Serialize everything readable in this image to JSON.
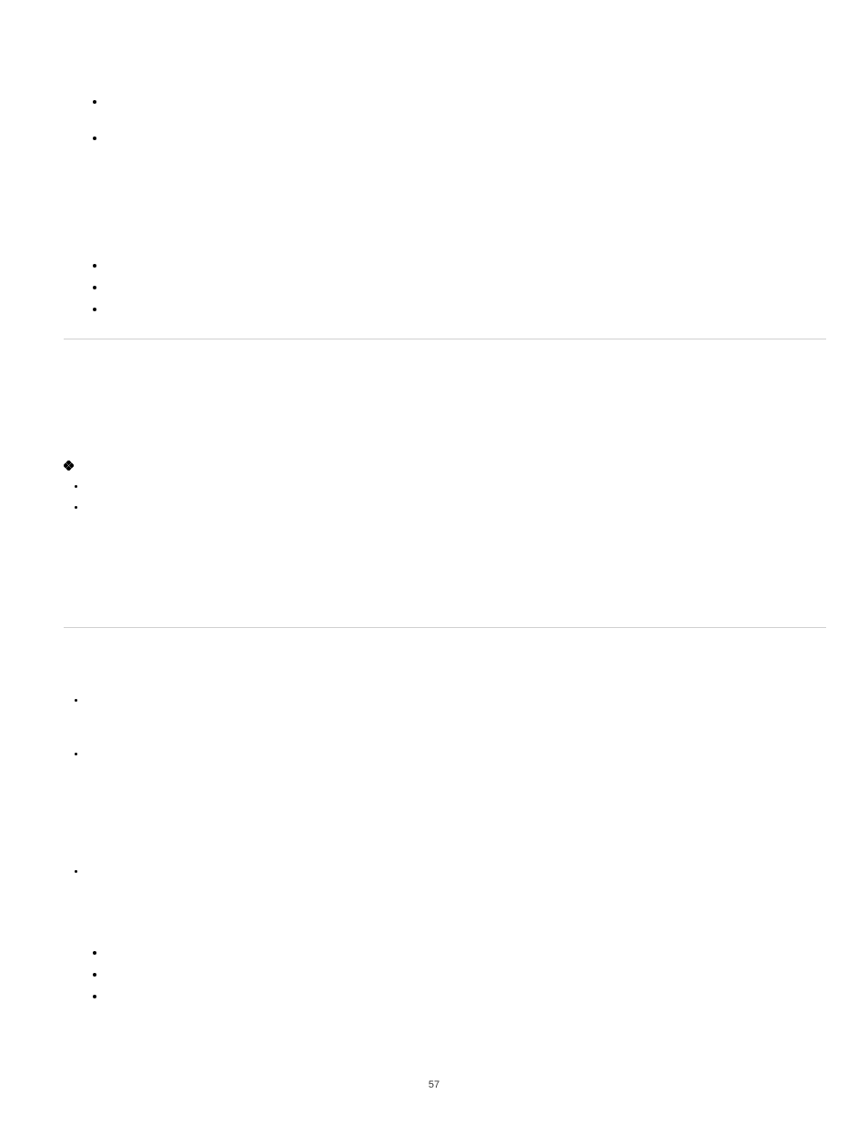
{
  "page_number": "57"
}
